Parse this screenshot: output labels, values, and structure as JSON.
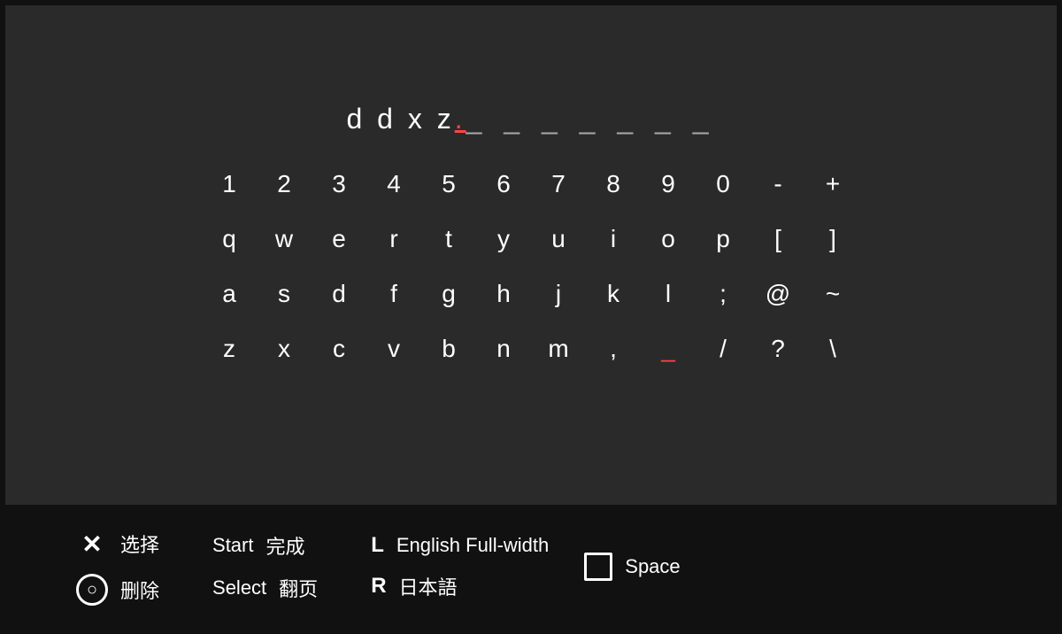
{
  "input": {
    "typed": "d d x z",
    "cursor": ".",
    "blanks": "_ _ _ _ _ _ _"
  },
  "keyboard": {
    "rows": [
      [
        "1",
        "2",
        "3",
        "4",
        "5",
        "6",
        "7",
        "8",
        "9",
        "0",
        "-",
        "+"
      ],
      [
        "q",
        "w",
        "e",
        "r",
        "t",
        "y",
        "u",
        "i",
        "o",
        "p",
        "[",
        "]"
      ],
      [
        "a",
        "s",
        "d",
        "f",
        "g",
        "h",
        "j",
        "k",
        "l",
        ";",
        "@",
        "~"
      ],
      [
        "z",
        "x",
        "c",
        "v",
        "b",
        "n",
        "m",
        ",",
        "_",
        "/",
        "?",
        "\\"
      ]
    ]
  },
  "controls": {
    "x_label": "选择",
    "circle_label": "删除",
    "start_label": "Start",
    "start_action": "完成",
    "select_label": "Select",
    "select_action": "翻页",
    "l_label": "L",
    "l_action": "English Full-width",
    "r_label": "R",
    "r_action": "日本語",
    "square_label": "Space"
  }
}
